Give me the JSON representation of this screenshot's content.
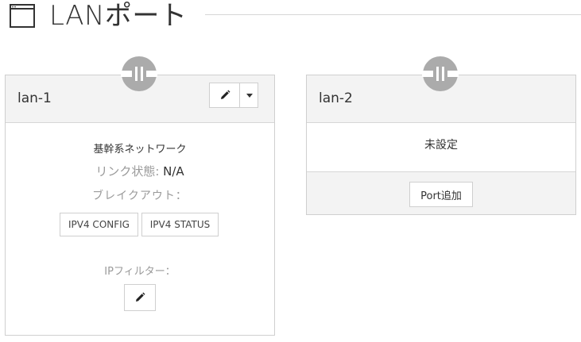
{
  "page": {
    "title": "LANポート"
  },
  "ports": [
    {
      "name": "lan-1",
      "network": "基幹系ネットワーク",
      "link_state_label": "リンク状態: ",
      "link_state_value": "N/A",
      "breakout_label": "ブレイクアウト：",
      "buttons": {
        "ipv4_config": "IPV4 CONFIG",
        "ipv4_status": "IPV4 STATUS"
      },
      "ip_filter_label": "IPフィルター："
    },
    {
      "name": "lan-2",
      "status": "未設定",
      "add_port_label": "Port追加"
    }
  ],
  "icons": {
    "header": "window-icon",
    "port": "ethernet-port-icon",
    "edit": "pencil-icon",
    "dropdown": "caret-down-icon"
  },
  "colors": {
    "icon_gray": "#ababab",
    "card_header_bg": "#f3f3f3",
    "border": "#cfcfcf"
  }
}
